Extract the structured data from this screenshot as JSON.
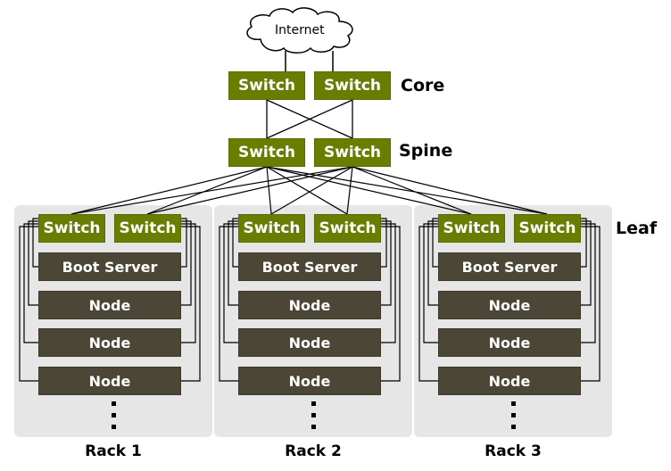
{
  "internet": {
    "label": "Internet"
  },
  "tiers": {
    "core": "Core",
    "spine": "Spine",
    "leaf": "Leaf"
  },
  "core_switches": [
    "Switch",
    "Switch"
  ],
  "spine_switches": [
    "Switch",
    "Switch"
  ],
  "racks": [
    {
      "label": "Rack 1",
      "switches": [
        "Switch",
        "Switch"
      ],
      "boot_server": "Boot Server",
      "nodes": [
        "Node",
        "Node",
        "Node"
      ]
    },
    {
      "label": "Rack 2",
      "switches": [
        "Switch",
        "Switch"
      ],
      "boot_server": "Boot Server",
      "nodes": [
        "Node",
        "Node",
        "Node"
      ]
    },
    {
      "label": "Rack 3",
      "switches": [
        "Switch",
        "Switch"
      ],
      "boot_server": "Boot Server",
      "nodes": [
        "Node",
        "Node",
        "Node"
      ]
    }
  ],
  "colors": {
    "switch": "#6a7d00",
    "server": "#4b4636",
    "rack_bg": "#e6e6e6"
  }
}
